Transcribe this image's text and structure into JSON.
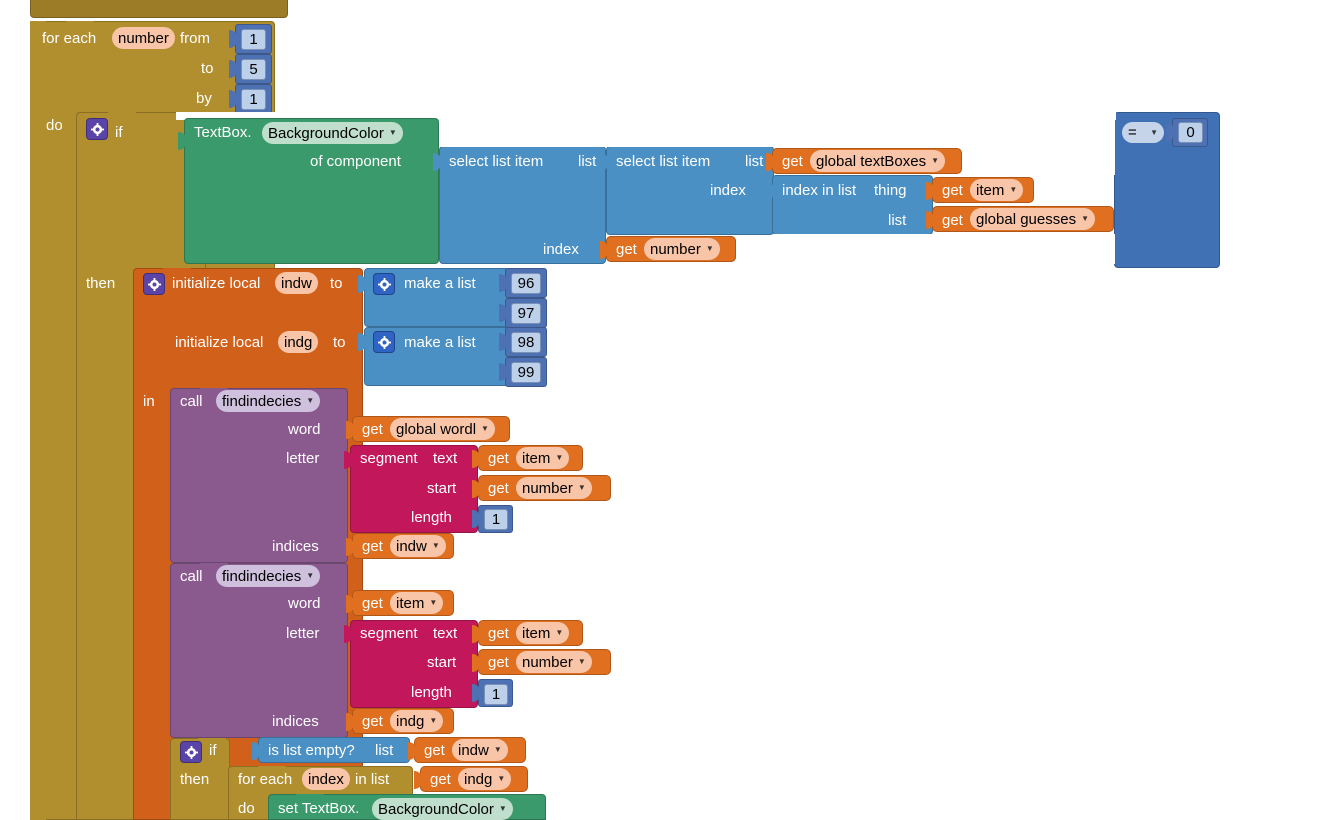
{
  "app": {
    "name": "MIT App Inventor Blocks Editor",
    "canvas_background": "#ffffff"
  },
  "colors": {
    "control_gold": "#b18e2e",
    "logic_blue": "#4071b5",
    "list_blue": "#4a90c4",
    "math_blue": "#4d71b3",
    "component_green": "#3a9a6b",
    "variable_orange": "#e0701f",
    "procedure_purple": "#8a5a8f",
    "text_crimson": "#c2185b"
  },
  "blocks": {
    "for_each_number": {
      "label": "for each",
      "var": "number",
      "from_label": "from",
      "from_value": "1",
      "to_label": "to",
      "to_value": "5",
      "by_label": "by",
      "by_value": "1",
      "do_label": "do"
    },
    "if_outer": {
      "if_label": "if",
      "then_label": "then",
      "gear_icon": "gear-icon"
    },
    "component_get": {
      "component": "TextBox.",
      "property": "BackgroundColor",
      "of_component_label": "of component"
    },
    "select_outer": {
      "label": "select list item",
      "list_label": "list",
      "index_label": "index",
      "index_value": "number",
      "get_label": "get"
    },
    "select_inner": {
      "label": "select list item",
      "list_label": "list",
      "list_value": "global textBoxes",
      "index_label": "index",
      "get_label": "get"
    },
    "index_in_list": {
      "label": "index in list",
      "thing_label": "thing",
      "thing_value": "item",
      "list_label": "list",
      "list_value": "global guesses",
      "get_label": "get"
    },
    "compare": {
      "operator": "=",
      "value": "0"
    },
    "init_local_indw": {
      "label": "initialize local",
      "var": "indw",
      "to_label": "to"
    },
    "init_local_indg": {
      "label": "initialize local",
      "var": "indg",
      "to_label": "to"
    },
    "make_a_list_1": {
      "label": "make a list",
      "items": [
        "96",
        "97"
      ]
    },
    "make_a_list_2": {
      "label": "make a list",
      "items": [
        "98",
        "99"
      ]
    },
    "in_label": "in",
    "call_findindecies_1": {
      "call_label": "call",
      "procedure": "findindecies",
      "word_label": "word",
      "word_get": "get",
      "word_value": "global wordl",
      "letter_label": "letter",
      "indices_label": "indices",
      "indices_get": "get",
      "indices_value": "indw"
    },
    "segment_1": {
      "label": "segment",
      "text_label": "text",
      "text_get": "get",
      "text_value": "item",
      "start_label": "start",
      "start_get": "get",
      "start_value": "number",
      "length_label": "length",
      "length_value": "1"
    },
    "call_findindecies_2": {
      "call_label": "call",
      "procedure": "findindecies",
      "word_label": "word",
      "word_get": "get",
      "word_value": "item",
      "letter_label": "letter",
      "indices_label": "indices",
      "indices_get": "get",
      "indices_value": "indg"
    },
    "segment_2": {
      "label": "segment",
      "text_label": "text",
      "text_get": "get",
      "text_value": "item",
      "start_label": "start",
      "start_get": "get",
      "start_value": "number",
      "length_label": "length",
      "length_value": "1"
    },
    "if_inner": {
      "if_label": "if",
      "then_label": "then",
      "gear_icon": "gear-icon"
    },
    "is_list_empty": {
      "label": "is list empty?",
      "list_label": "list",
      "get_label": "get",
      "value": "indw"
    },
    "for_each_index": {
      "label": "for each",
      "var": "index",
      "in_list_label": "in list",
      "get_label": "get",
      "list_value": "indg",
      "do_label": "do"
    },
    "set_textbox": {
      "label": "set TextBox.",
      "property": "BackgroundColor"
    }
  }
}
